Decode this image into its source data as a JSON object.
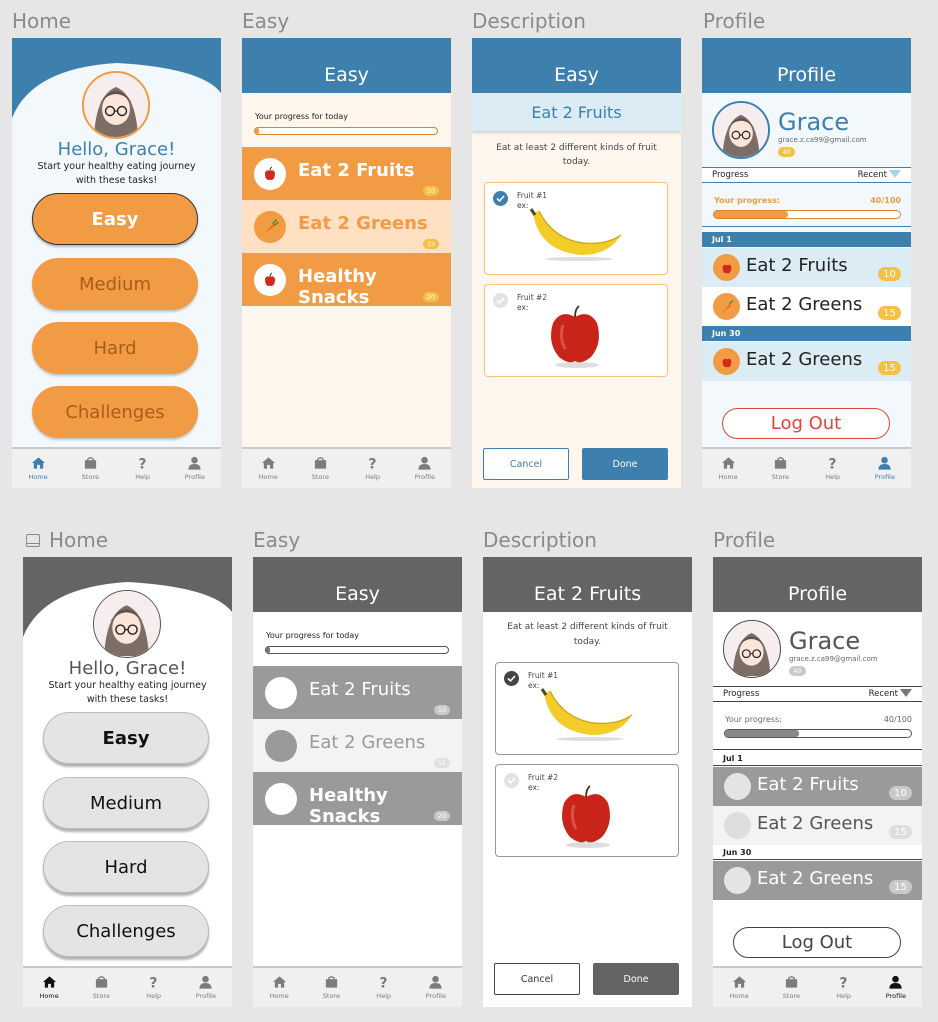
{
  "frame_titles": [
    "Home",
    "Easy",
    "Description",
    "Profile",
    "Home",
    "Easy",
    "Description",
    "Profile"
  ],
  "colors": {
    "blue": "#3d7fad",
    "orange": "#f29b45",
    "orange_light": "#ffe0c3",
    "cream": "#fff6ee",
    "home_bg": "#f2f8fb",
    "gray_header": "#646464",
    "gray_task": "#9a9a9a",
    "gray_light": "#f3f3f3"
  },
  "nav": {
    "home": "Home",
    "store": "Store",
    "help": "Help",
    "profile": "Profile"
  },
  "home": {
    "greeting": "Hello, Grace!",
    "subtitle_1": "Start your healthy eating journey",
    "subtitle_2": "with these tasks!",
    "buttons": [
      "Easy",
      "Medium",
      "Hard",
      "Challenges"
    ]
  },
  "easy": {
    "title": "Easy",
    "progress_label": "Your progress for today",
    "progress": 0.02,
    "tasks": [
      {
        "name": "Eat 2 Fruits",
        "points": "10",
        "icon": "apple-icon"
      },
      {
        "name": "Eat 2 Greens",
        "points": "15",
        "icon": "carrot-icon"
      },
      {
        "name": "Healthy Snacks",
        "points": "20",
        "icon": "apple-icon"
      }
    ]
  },
  "description": {
    "header": "Easy",
    "task_title": "Eat 2 Fruits",
    "text_1": "Eat at least 2 different kinds of fruit",
    "text_2": "today.",
    "fruits": [
      {
        "label": "Fruit #1",
        "ex": "ex:",
        "checked": true,
        "image": "banana"
      },
      {
        "label": "Fruit #2",
        "ex": "ex:",
        "checked": false,
        "image": "apple"
      }
    ],
    "cancel": "Cancel",
    "done": "Done"
  },
  "profile": {
    "title": "Profile",
    "name": "Grace",
    "email": "grace.z.ca99@gmail.com",
    "points": "40",
    "progress_label": "Progress",
    "filter": "Recent",
    "your_progress": "Your progress:",
    "progress_value": "40/100",
    "progress": 0.4,
    "groups": [
      {
        "date": "Jul 1",
        "items": [
          {
            "name": "Eat 2 Fruits",
            "points": "10",
            "icon": "apple-icon"
          },
          {
            "name": "Eat 2 Greens",
            "points": "15",
            "icon": "carrot-icon"
          }
        ]
      },
      {
        "date": "Jun 30",
        "items": [
          {
            "name": "Eat 2 Greens",
            "points": "15",
            "icon": "apple-icon"
          }
        ]
      }
    ],
    "logout": "Log Out"
  }
}
